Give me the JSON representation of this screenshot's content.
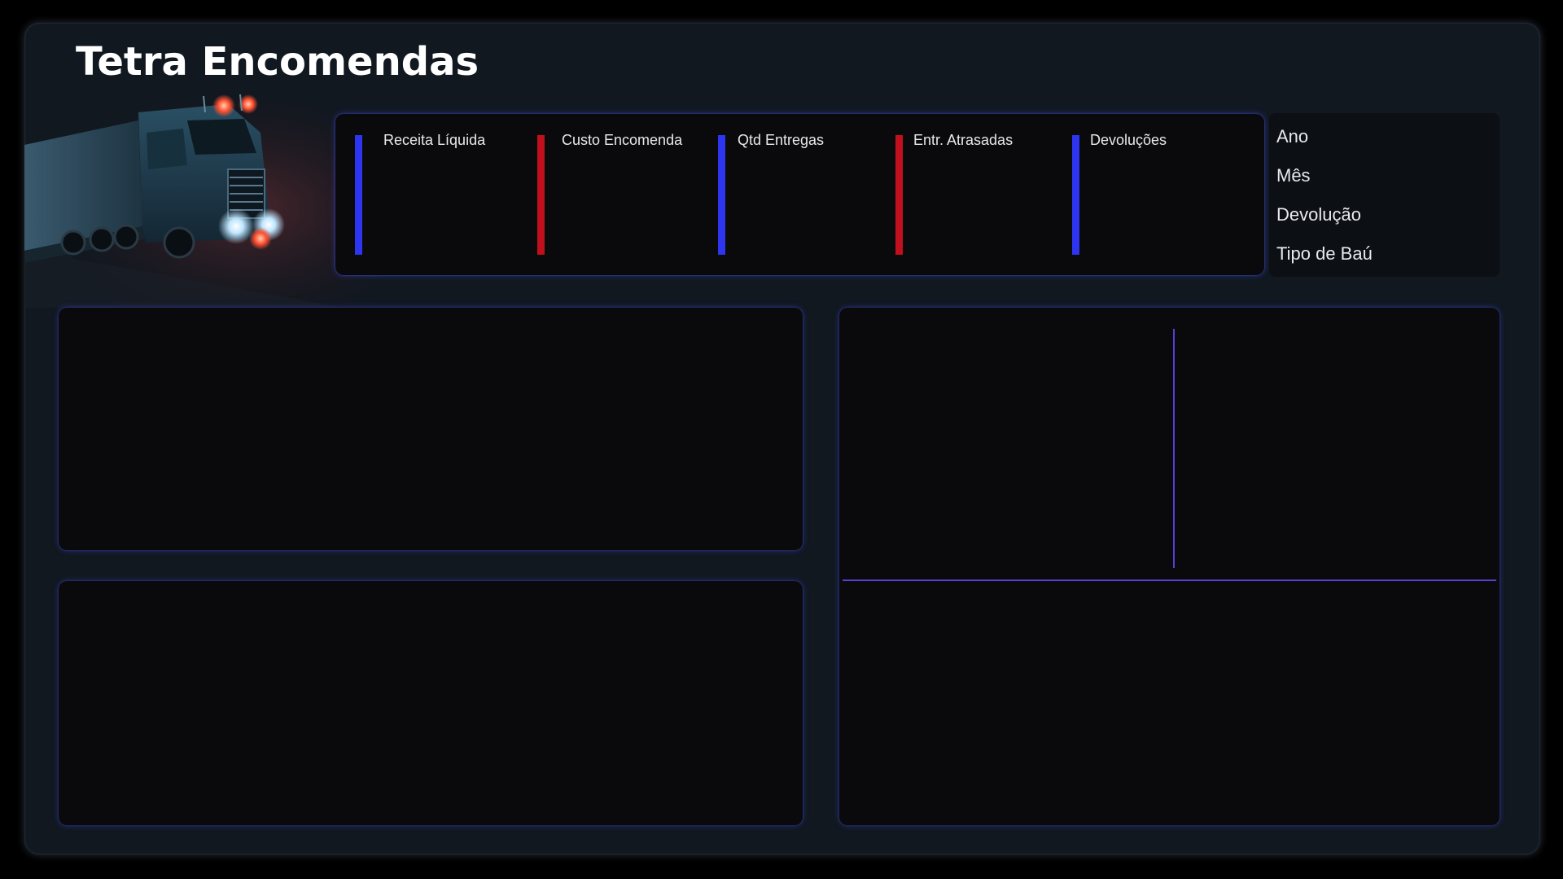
{
  "header": {
    "title": "Tetra Encomendas"
  },
  "kpis": [
    {
      "label": "Receita Líquida",
      "color": "#2d35f0"
    },
    {
      "label": "Custo Encomenda",
      "color": "#c0101c"
    },
    {
      "label": "Qtd Entregas",
      "color": "#2d35f0"
    },
    {
      "label": "Entr. Atrasadas",
      "color": "#c0101c"
    },
    {
      "label": "Devoluções",
      "color": "#2d35f0"
    }
  ],
  "filters": [
    {
      "label": "Ano"
    },
    {
      "label": "Mês"
    },
    {
      "label": "Devolução"
    },
    {
      "label": "Tipo de Baú"
    }
  ],
  "colors": {
    "background": "#000000",
    "frame": "#111820",
    "panel": "#0a0a0c",
    "accent_blue": "#2d35f0",
    "accent_red": "#c0101c",
    "divider": "#5a3fd6"
  },
  "icons": {
    "hero": "truck-icon"
  }
}
